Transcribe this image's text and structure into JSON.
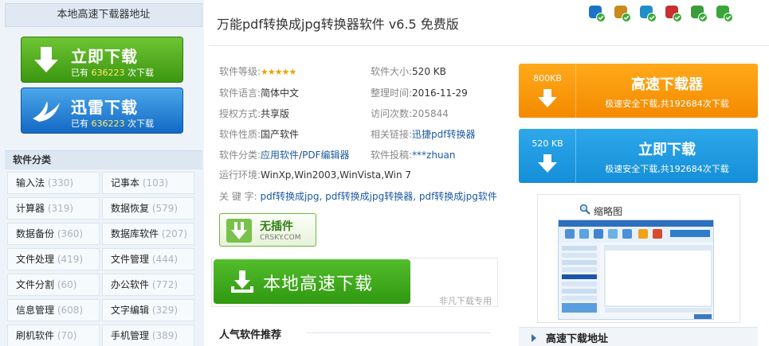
{
  "left": {
    "header": "本地高速下载器地址",
    "btn1": {
      "title": "立即下载",
      "pre": "已有",
      "count": "636223",
      "post": "次下载"
    },
    "btn2": {
      "title": "迅雷下载",
      "pre": "已有",
      "count": "636223",
      "post": "次下载"
    },
    "category_title": "软件分类",
    "categories": [
      {
        "name": "输入法",
        "count": "(330)"
      },
      {
        "name": "记事本",
        "count": "(103)"
      },
      {
        "name": "计算器",
        "count": "(319)"
      },
      {
        "name": "数据恢复",
        "count": "(579)"
      },
      {
        "name": "数据备份",
        "count": "(360)"
      },
      {
        "name": "数据库软件",
        "count": "(207)"
      },
      {
        "name": "文件处理",
        "count": "(419)"
      },
      {
        "name": "文件管理",
        "count": "(444)"
      },
      {
        "name": "文件分割",
        "count": "(60)"
      },
      {
        "name": "办公软件",
        "count": "(772)"
      },
      {
        "name": "信息管理",
        "count": "(608)"
      },
      {
        "name": "文字编辑",
        "count": "(329)"
      },
      {
        "name": "刷机软件",
        "count": "(70)"
      },
      {
        "name": "手机管理",
        "count": "(389)"
      }
    ]
  },
  "main": {
    "title": "万能pdf转换成jpg转换器软件 v6.5 免费版",
    "info": {
      "grade_label": "软件等级:",
      "grade_stars": "★★★★★",
      "size_label": "软件大小:",
      "size_value": "520 KB",
      "lang_label": "软件语言:",
      "lang_value": "简体中文",
      "date_label": "整理时间:",
      "date_value": "2016-11-29",
      "license_label": "授权方式:",
      "license_value": "共享版",
      "visits_label": "访问次数:",
      "visits_value": "205844",
      "nature_label": "软件性质:",
      "nature_value": "国产软件",
      "related_label": "相关链接:",
      "related_value": "迅捷pdf转换器",
      "cat_label": "软件分类:",
      "cat_value1": "应用软件",
      "cat_sep": "/",
      "cat_value2": "PDF编辑器",
      "submit_label": "软件投稿:",
      "submit_value": "***zhuan",
      "env_label": "运行环境:",
      "env_value": "WinXp,Win2003,WinVista,Win 7",
      "kw_label": "关 键 字:",
      "kw_value": "pdf转换成jpg, pdf转换成jpg转换器, pdf转换成jpg软件"
    },
    "noplugin": {
      "title": "无插件",
      "sub": "CRSKY.COM"
    },
    "local_btn": "本地高速下载",
    "local_note": "非凡下载专用",
    "hot_title": "人气软件推荐"
  },
  "right": {
    "dl1": {
      "size": "800KB",
      "title": "高速下载器",
      "sub": "极速安全下载,共192684次下载"
    },
    "dl2": {
      "size": "520 KB",
      "title": "立即下载",
      "sub": "极速安全下载,共192684次下载"
    },
    "thumb_label": "缩略图",
    "fast_title": "高速下载地址"
  },
  "top_icons": [
    "shield-check-icon",
    "lion-check-icon",
    "globe-check-icon",
    "k-check-icon",
    "defender-check-icon",
    "plus-check-icon"
  ]
}
